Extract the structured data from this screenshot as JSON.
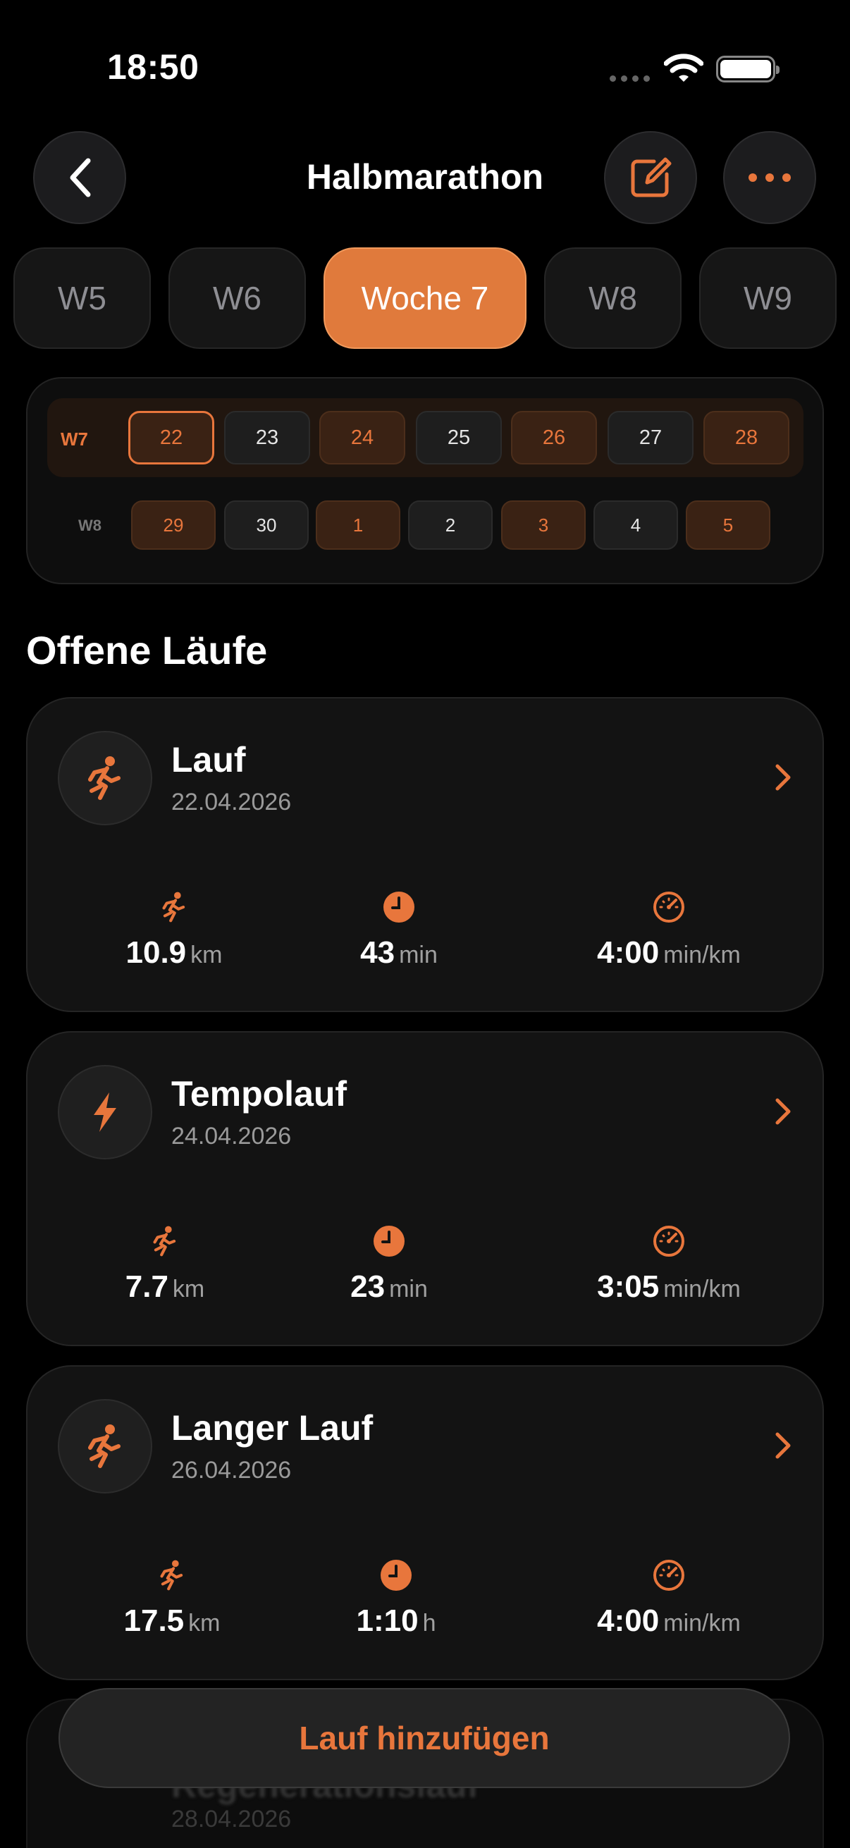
{
  "status": {
    "time": "18:50"
  },
  "header": {
    "title": "Halbmarathon"
  },
  "weeks": [
    "W5",
    "W6",
    "Woche 7",
    "W8",
    "W9"
  ],
  "calendar": {
    "row1_label": "W7",
    "row1": [
      "22",
      "23",
      "24",
      "25",
      "26",
      "27",
      "28"
    ],
    "row2_label": "W8",
    "row2": [
      "29",
      "30",
      "1",
      "2",
      "3",
      "4",
      "5"
    ]
  },
  "section_title": "Offene Läufe",
  "runs": [
    {
      "title": "Lauf",
      "date": "22.04.2026",
      "distance": "10.9",
      "distance_unit": "km",
      "duration": "43",
      "duration_unit": "min",
      "pace": "4:00",
      "pace_unit": "min/km",
      "icon": "runner-icon"
    },
    {
      "title": "Tempolauf",
      "date": "24.04.2026",
      "distance": "7.7",
      "distance_unit": "km",
      "duration": "23",
      "duration_unit": "min",
      "pace": "3:05",
      "pace_unit": "min/km",
      "icon": "bolt-icon"
    },
    {
      "title": "Langer Lauf",
      "date": "26.04.2026",
      "distance": "17.5",
      "distance_unit": "km",
      "duration": "1:10",
      "duration_unit": "h",
      "pace": "4:00",
      "pace_unit": "min/km",
      "icon": "runner-icon"
    }
  ],
  "partial_run": {
    "title": "Regenerationslauf",
    "date": "28.04.2026"
  },
  "add_button": "Lauf hinzufügen",
  "colors": {
    "accent": "#e8763c",
    "background": "#000000",
    "card": "#131313"
  }
}
